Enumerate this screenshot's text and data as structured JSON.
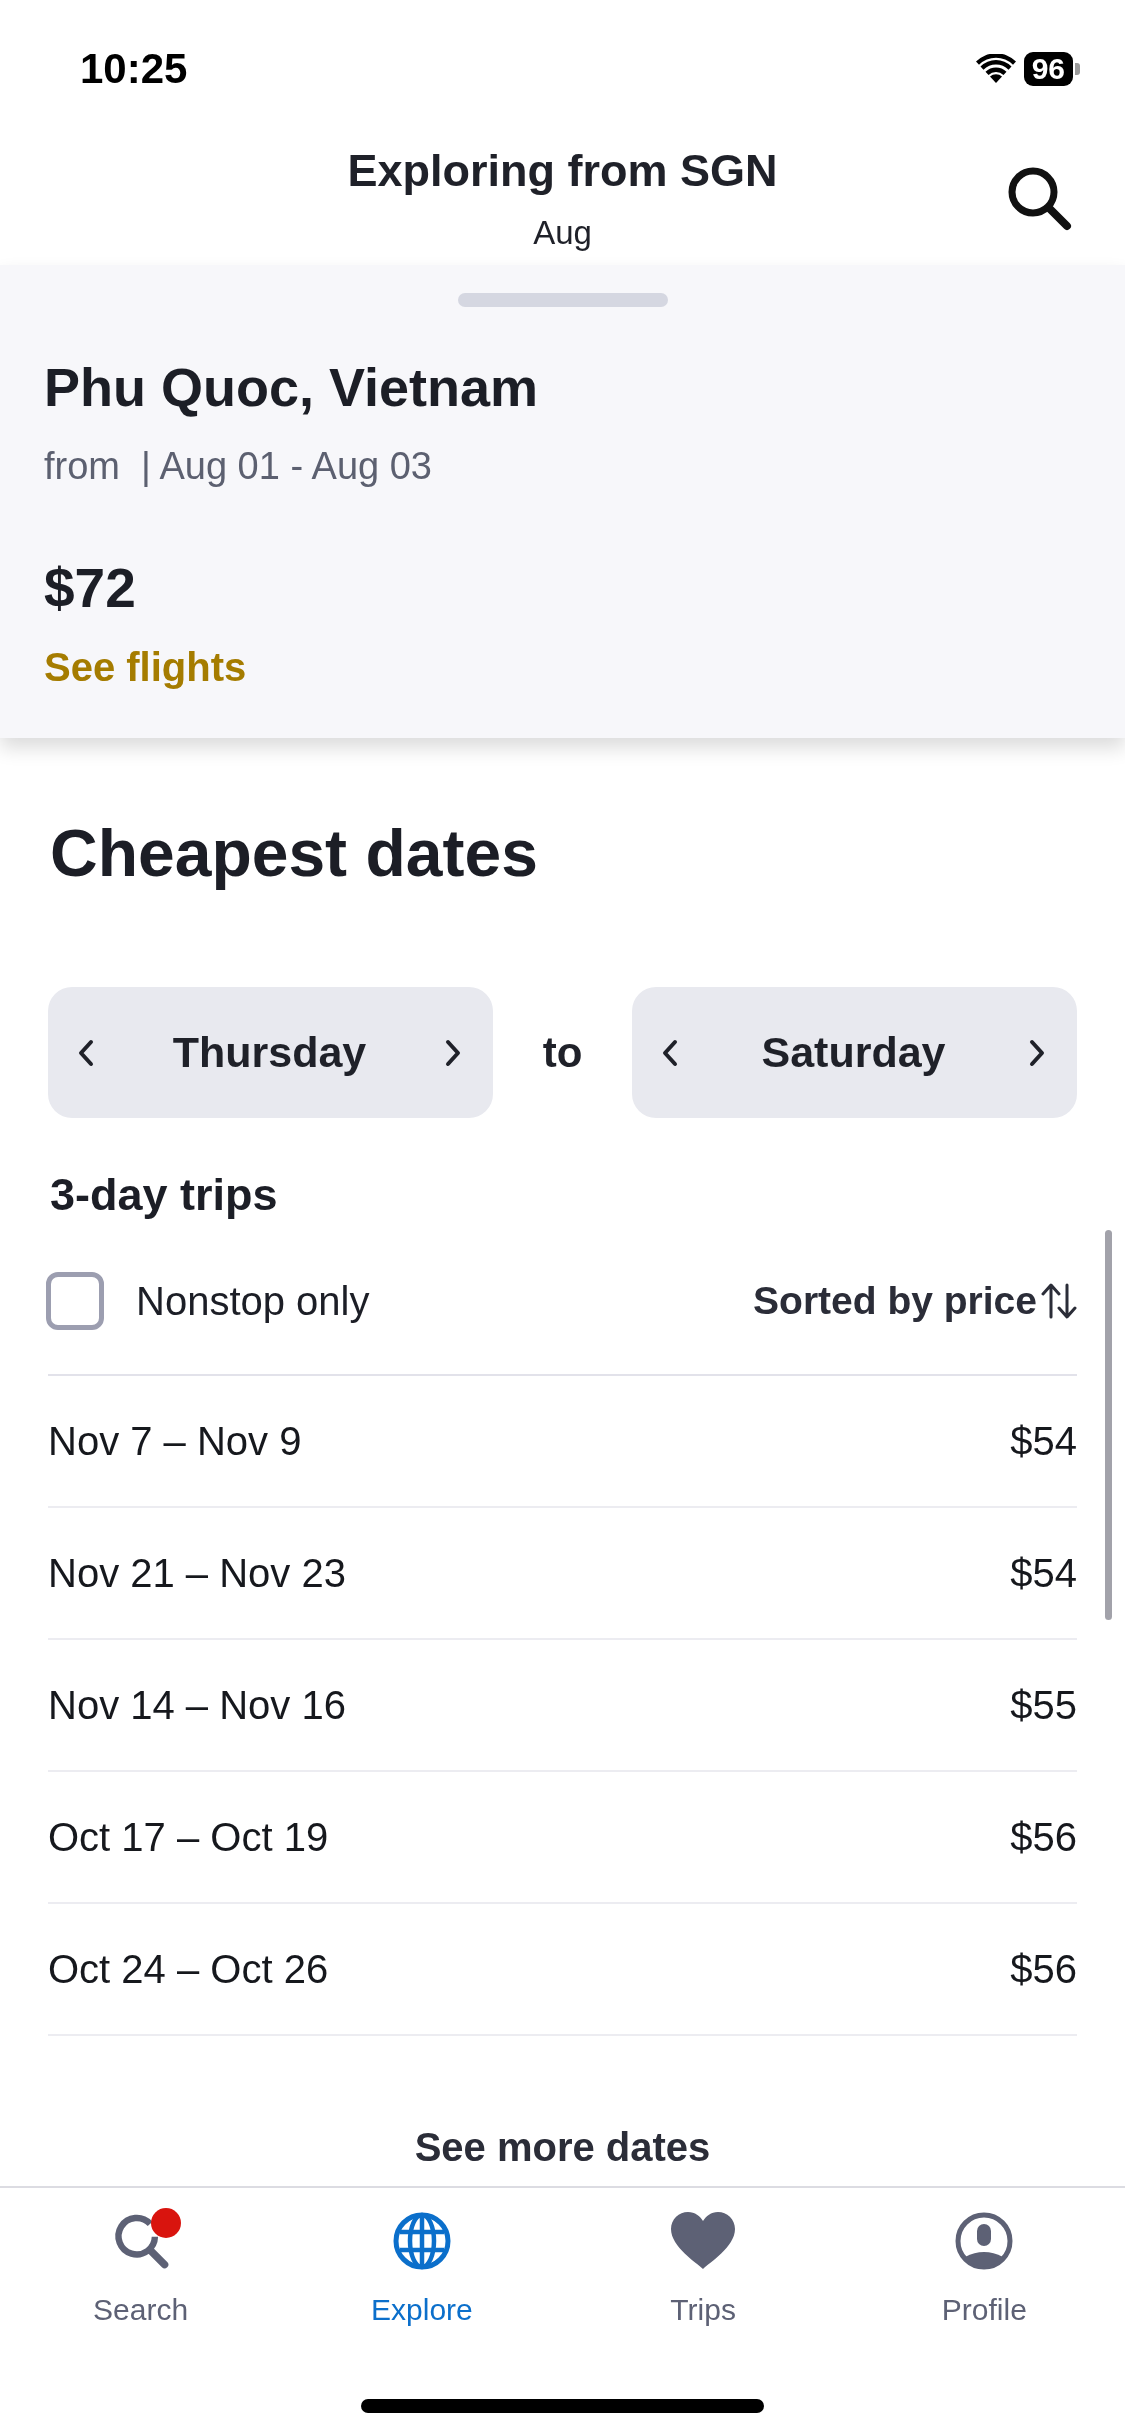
{
  "status_bar": {
    "time": "10:25",
    "battery": "96"
  },
  "header": {
    "title": "Exploring from SGN",
    "subtitle": "Aug"
  },
  "destination_card": {
    "name": "Phu Quoc, Vietnam",
    "details": "from  | Aug 01 - Aug 03",
    "price": "$72",
    "link": "See flights"
  },
  "cheapest_dates": {
    "title": "Cheapest dates",
    "start_day": "Thursday",
    "connector": "to",
    "end_day": "Saturday",
    "trip_length": "3-day trips",
    "nonstop_filter": {
      "label": "Nonstop only",
      "checked": false
    },
    "sort": "Sorted by price",
    "rows": [
      {
        "dates": "Nov 7 – Nov 9",
        "price": "$54"
      },
      {
        "dates": "Nov 21 – Nov 23",
        "price": "$54"
      },
      {
        "dates": "Nov 14 – Nov 16",
        "price": "$55"
      },
      {
        "dates": "Oct 17 – Oct 19",
        "price": "$56"
      },
      {
        "dates": "Oct 24 – Oct 26",
        "price": "$56"
      }
    ],
    "more_link": "See more dates"
  },
  "tab_bar": [
    {
      "label": "Search",
      "selected": false,
      "badge": true
    },
    {
      "label": "Explore",
      "selected": true,
      "badge": false
    },
    {
      "label": "Trips",
      "selected": false,
      "badge": false
    },
    {
      "label": "Profile",
      "selected": false,
      "badge": false
    }
  ]
}
